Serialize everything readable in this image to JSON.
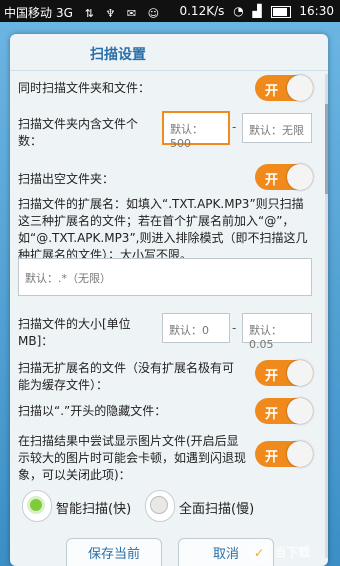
{
  "status_bar": {
    "carrier": "中国移动",
    "network": "3G",
    "speed": "0.12K/s",
    "time": "16:30"
  },
  "dialog": {
    "title": "扫描设置",
    "toggle_on_label": "开",
    "rows": {
      "scan_folders_and_files": {
        "label": "同时扫描文件夹和文件：",
        "state": "on"
      },
      "folder_file_count": {
        "label": "扫描文件夹内含文件个数：",
        "min_placeholder": "默认：500",
        "max_placeholder": "默认：无限",
        "separator": "-"
      },
      "scan_empty_folder": {
        "label": "扫描出空文件夹：",
        "state": "on"
      },
      "extensions": {
        "label": "扫描文件的扩展名：如填入“.TXT.APK.MP3”则只扫描这三种扩展名的文件；若在首个扩展名前加入“@”，如“@.TXT.APK.MP3”,则进入排除模式（即不扫描这几种扩展名的文件）；大小写不限。",
        "placeholder": "默认：.*（无限）"
      },
      "file_size": {
        "label": "扫描文件的大小[单位MB]：",
        "min_placeholder": "默认：0",
        "max_placeholder": "默认：0.05",
        "separator": "-"
      },
      "no_extension": {
        "label": "扫描无扩展名的文件（没有扩展名极有可能为缓存文件）：",
        "state": "on"
      },
      "hidden_files": {
        "label": "扫描以“.”开头的隐藏文件：",
        "state": "on"
      },
      "show_images": {
        "label": "在扫描结果中尝试显示图片文件(开启后显示较大的图片时可能会卡顿，如遇到闪退现象，可以关闭此项)：",
        "state": "on"
      }
    },
    "scan_mode": {
      "options": [
        "智能扫描(快)",
        "全面扫描(慢)"
      ],
      "selected": "智能扫描(快)"
    },
    "buttons": {
      "save": "保存当前",
      "cancel": "取消"
    },
    "watermark": "当下载"
  }
}
